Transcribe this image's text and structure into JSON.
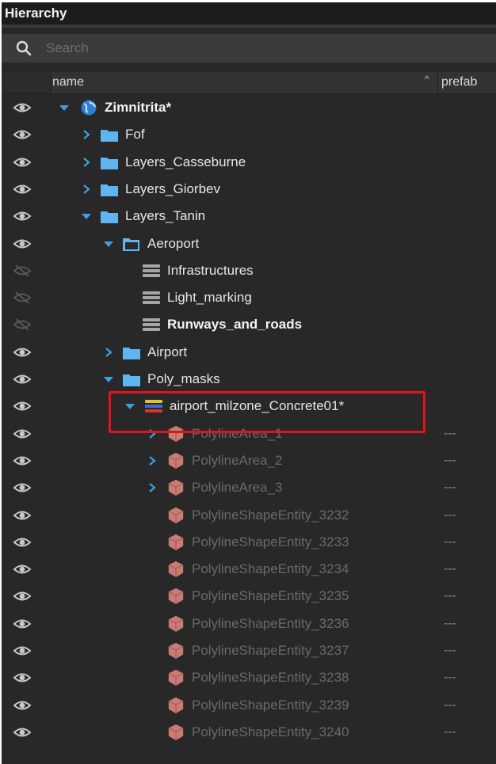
{
  "panel": {
    "title": "Hierarchy"
  },
  "search": {
    "placeholder": "Search",
    "value": ""
  },
  "columns": {
    "name": "name",
    "prefab": "prefab",
    "sort_indicator": "^"
  },
  "rows": [
    {
      "label": "Zimnitrita*",
      "icon": "globe-icon",
      "arrow": "expanded",
      "visible": true,
      "bold": true,
      "dim": false,
      "prefab": ""
    },
    {
      "label": "Fof",
      "icon": "folder-icon",
      "arrow": "collapsed",
      "visible": true,
      "bold": false,
      "dim": false,
      "prefab": ""
    },
    {
      "label": "Layers_Casseburne",
      "icon": "folder-icon",
      "arrow": "collapsed",
      "visible": true,
      "bold": false,
      "dim": false,
      "prefab": ""
    },
    {
      "label": "Layers_Giorbev",
      "icon": "folder-icon",
      "arrow": "collapsed",
      "visible": true,
      "bold": false,
      "dim": false,
      "prefab": ""
    },
    {
      "label": "Layers_Tanin",
      "icon": "folder-icon",
      "arrow": "expanded",
      "visible": true,
      "bold": false,
      "dim": false,
      "prefab": ""
    },
    {
      "label": "Aeroport",
      "icon": "folder-open-icon",
      "arrow": "expanded",
      "visible": true,
      "bold": false,
      "dim": false,
      "prefab": ""
    },
    {
      "label": "Infrastructures",
      "icon": "layer-icon",
      "arrow": "none",
      "visible": false,
      "bold": false,
      "dim": false,
      "prefab": ""
    },
    {
      "label": "Light_marking",
      "icon": "layer-icon",
      "arrow": "none",
      "visible": false,
      "bold": false,
      "dim": false,
      "prefab": ""
    },
    {
      "label": "Runways_and_roads",
      "icon": "layer-icon",
      "arrow": "none",
      "visible": false,
      "bold": true,
      "dim": false,
      "prefab": ""
    },
    {
      "label": "Airport",
      "icon": "folder-icon",
      "arrow": "collapsed",
      "visible": true,
      "bold": false,
      "dim": false,
      "prefab": ""
    },
    {
      "label": "Poly_masks",
      "icon": "folder-icon",
      "arrow": "expanded",
      "visible": true,
      "bold": false,
      "dim": false,
      "prefab": ""
    },
    {
      "label": "airport_milzone_Concrete01*",
      "icon": "colored-layer-icon",
      "arrow": "expanded",
      "visible": true,
      "bold": false,
      "dim": false,
      "prefab": ""
    },
    {
      "label": "PolylineArea_1",
      "icon": "entity-cube-icon",
      "arrow": "collapsed",
      "visible": true,
      "bold": false,
      "dim": true,
      "prefab": "---"
    },
    {
      "label": "PolylineArea_2",
      "icon": "entity-cube-icon",
      "arrow": "collapsed",
      "visible": true,
      "bold": false,
      "dim": true,
      "prefab": "---"
    },
    {
      "label": "PolylineArea_3",
      "icon": "entity-cube-icon",
      "arrow": "collapsed",
      "visible": true,
      "bold": false,
      "dim": true,
      "prefab": "---"
    },
    {
      "label": "PolylineShapeEntity_3232",
      "icon": "entity-cube-icon",
      "arrow": "none",
      "visible": true,
      "bold": false,
      "dim": true,
      "prefab": "---"
    },
    {
      "label": "PolylineShapeEntity_3233",
      "icon": "entity-cube-icon",
      "arrow": "none",
      "visible": true,
      "bold": false,
      "dim": true,
      "prefab": "---"
    },
    {
      "label": "PolylineShapeEntity_3234",
      "icon": "entity-cube-icon",
      "arrow": "none",
      "visible": true,
      "bold": false,
      "dim": true,
      "prefab": "---"
    },
    {
      "label": "PolylineShapeEntity_3235",
      "icon": "entity-cube-icon",
      "arrow": "none",
      "visible": true,
      "bold": false,
      "dim": true,
      "prefab": "---"
    },
    {
      "label": "PolylineShapeEntity_3236",
      "icon": "entity-cube-icon",
      "arrow": "none",
      "visible": true,
      "bold": false,
      "dim": true,
      "prefab": "---"
    },
    {
      "label": "PolylineShapeEntity_3237",
      "icon": "entity-cube-icon",
      "arrow": "none",
      "visible": true,
      "bold": false,
      "dim": true,
      "prefab": "---"
    },
    {
      "label": "PolylineShapeEntity_3238",
      "icon": "entity-cube-icon",
      "arrow": "none",
      "visible": true,
      "bold": false,
      "dim": true,
      "prefab": "---"
    },
    {
      "label": "PolylineShapeEntity_3239",
      "icon": "entity-cube-icon",
      "arrow": "none",
      "visible": true,
      "bold": false,
      "dim": true,
      "prefab": "---"
    },
    {
      "label": "PolylineShapeEntity_3240",
      "icon": "entity-cube-icon",
      "arrow": "none",
      "visible": true,
      "bold": false,
      "dim": true,
      "prefab": "---"
    }
  ],
  "colors": {
    "background": "#282828",
    "arrow_expanded": "#3c9fe3",
    "arrow_collapsed": "#3c9fe3",
    "folder": "#5fb5f0",
    "entity": "#c97b74",
    "highlight_border": "#e0141b"
  }
}
